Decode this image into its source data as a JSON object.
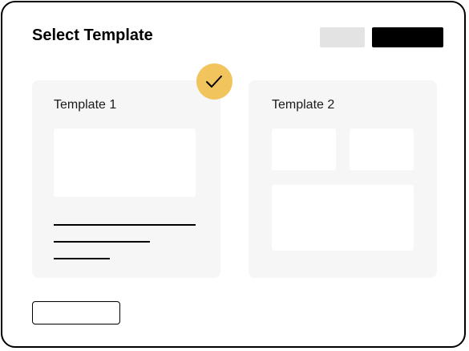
{
  "dialog": {
    "title": "Select Template"
  },
  "templates": [
    {
      "label": "Template 1",
      "selected": true
    },
    {
      "label": "Template 2",
      "selected": false
    }
  ],
  "colors": {
    "accent": "#f2c45e",
    "card_background": "#f6f6f6",
    "secondary_button": "#e3e3e3",
    "primary_button": "#000000"
  },
  "icons": {
    "selected_badge": "checkmark-icon"
  }
}
